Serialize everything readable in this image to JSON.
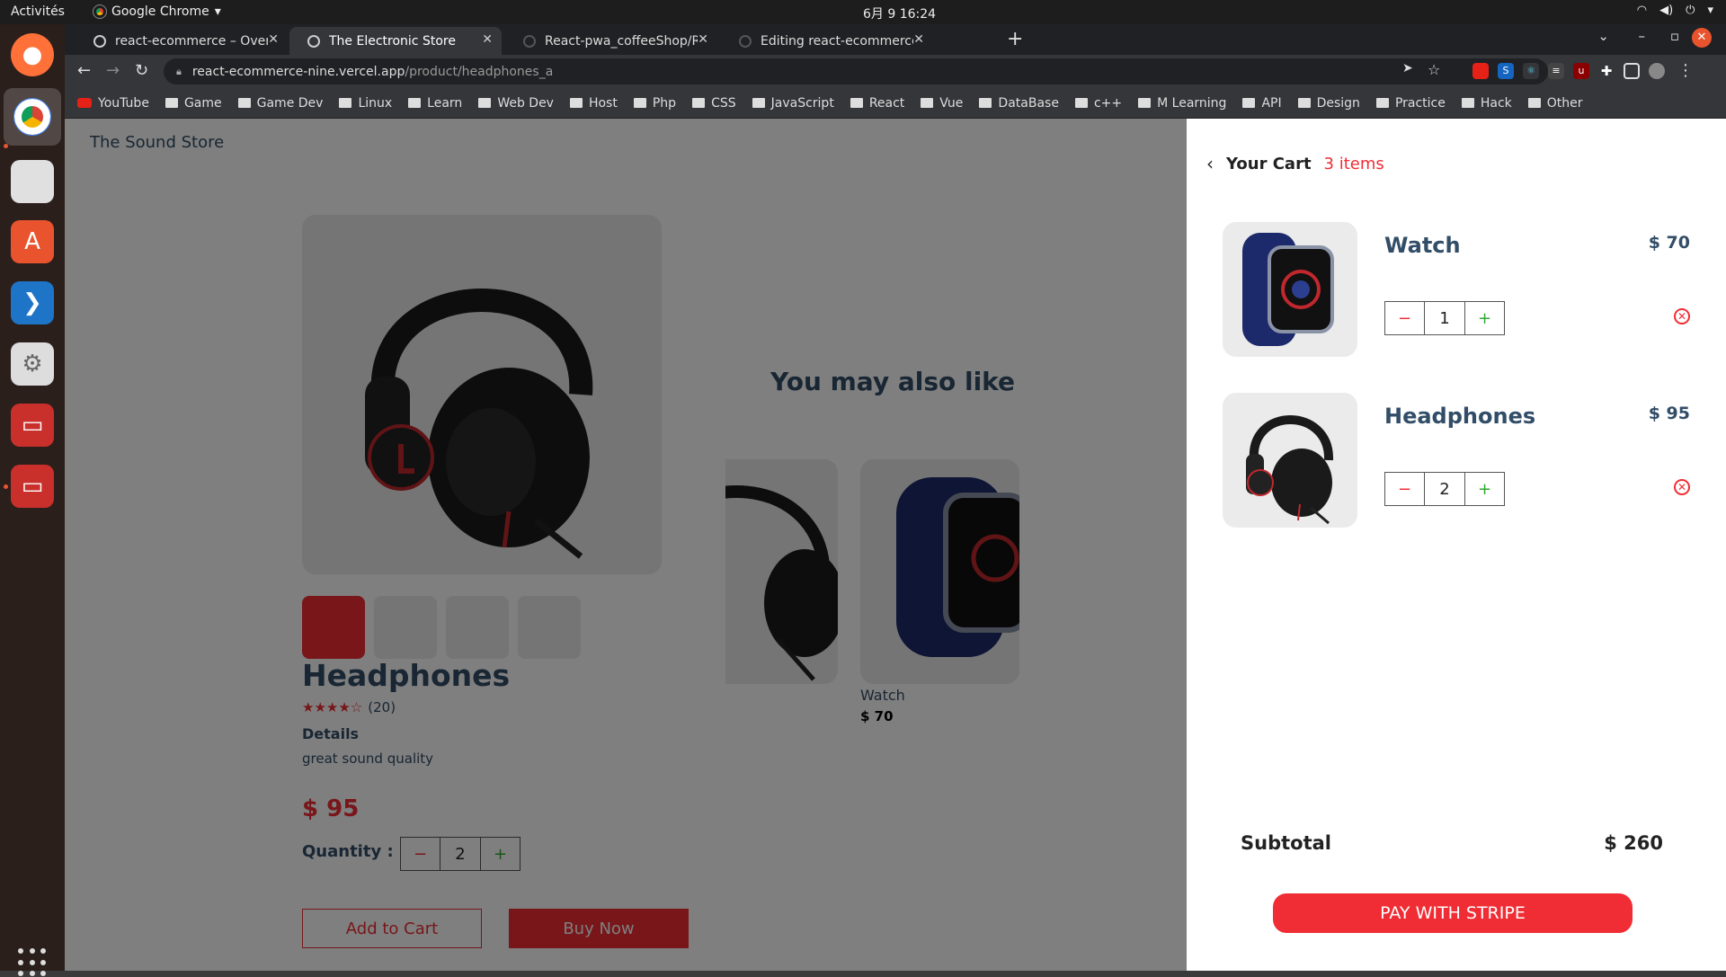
{
  "os": {
    "activities": "Activités",
    "app_name": "Google Chrome",
    "clock": "6月 9  16:24"
  },
  "browser": {
    "tabs": [
      {
        "title": "react-ecommerce – Overv"
      },
      {
        "title": "The Electronic Store"
      },
      {
        "title": "React-pwa_coffeeShop/R"
      },
      {
        "title": "Editing react-ecommerce/"
      }
    ],
    "url_host": "react-ecommerce-nine.vercel.app",
    "url_path": "/product/headphones_a",
    "bookmarks": [
      "YouTube",
      "Game",
      "Game Dev",
      "Linux",
      "Learn",
      "Web Dev",
      "Host",
      "Php",
      "CSS",
      "JavaScript",
      "React",
      "Vue",
      "DataBase",
      "c++",
      "M Learning",
      "API",
      "Design",
      "Practice",
      "Hack",
      "Other"
    ]
  },
  "store": {
    "logo": "The Sound Store"
  },
  "product": {
    "name": "Headphones",
    "stars": "★★★★☆",
    "review_count": "(20)",
    "details_label": "Details",
    "details": "great sound quality",
    "price": "$ 95",
    "quantity_label": "Quantity :",
    "quantity": "2",
    "add_to_cart": "Add to Cart",
    "buy_now": "Buy Now"
  },
  "also_like": {
    "title": "You may also like",
    "card_name": "Watch",
    "card_price": "$ 70"
  },
  "cart": {
    "title": "Your Cart",
    "count": "3 items",
    "items": [
      {
        "name": "Watch",
        "price": "$ 70",
        "qty": "1"
      },
      {
        "name": "Headphones",
        "price": "$ 95",
        "qty": "2"
      }
    ],
    "subtotal_label": "Subtotal",
    "subtotal": "$ 260",
    "pay_button": "PAY WITH STRIPE"
  },
  "colors": {
    "accent": "#f02d34",
    "text": "#324d67"
  }
}
